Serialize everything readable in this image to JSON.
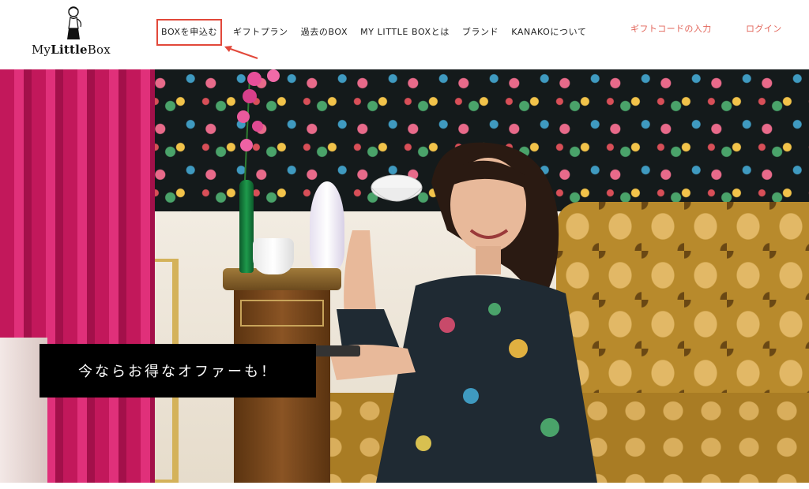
{
  "header": {
    "logo": {
      "text_regular": "My",
      "text_bold": "Little",
      "text_end": "Box"
    },
    "nav": [
      {
        "label": "BOXを申込む",
        "highlighted": true
      },
      {
        "label": "ギフトプラン"
      },
      {
        "label": "過去のBOX"
      },
      {
        "label": "MY LITTLE BOXとは"
      },
      {
        "label": "ブランド"
      },
      {
        "label": "KANAKOについて"
      }
    ],
    "utility": {
      "gift_code": "ギフトコードの入力",
      "login": "ログイン"
    }
  },
  "hero": {
    "cta_label": "今ならお得なオファーも！"
  },
  "colors": {
    "accent": "#e2655a",
    "highlight_box": "#e2483a",
    "cta_background": "#000000"
  },
  "icons": [
    "logo-figure-icon",
    "annotation-arrow-icon"
  ]
}
